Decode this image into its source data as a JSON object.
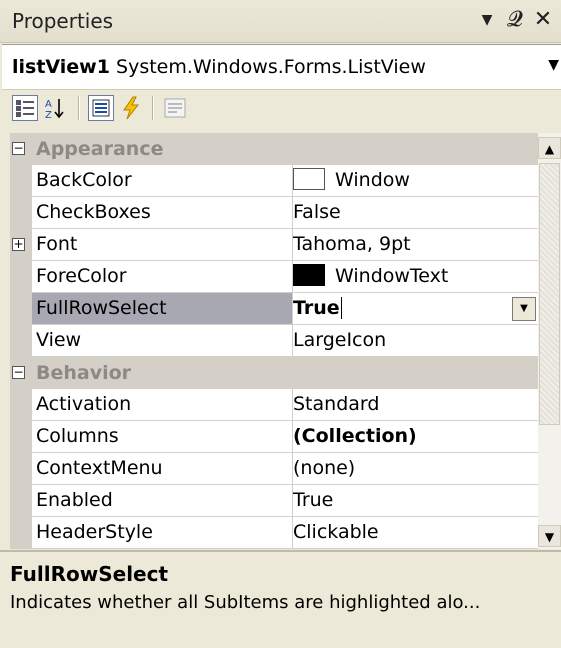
{
  "window": {
    "title": "Properties"
  },
  "object_selector": {
    "name": "listView1",
    "type": "System.Windows.Forms.ListView"
  },
  "toolbar": {
    "buttons": [
      "categorized-icon",
      "alphabetical-icon",
      "properties-icon",
      "events-icon",
      "property-pages-icon"
    ]
  },
  "grid": {
    "appearance_label": "Appearance",
    "behavior_label": "Behavior",
    "rows": [
      {
        "name": "BackColor",
        "value": "Window",
        "swatch": "#ffffff"
      },
      {
        "name": "CheckBoxes",
        "value": "False"
      },
      {
        "name": "Font",
        "value": "Tahoma, 9pt"
      },
      {
        "name": "ForeColor",
        "value": "WindowText",
        "swatch": "#000000"
      },
      {
        "name": "FullRowSelect",
        "value": "True"
      },
      {
        "name": "View",
        "value": "LargeIcon"
      },
      {
        "name": "Activation",
        "value": "Standard"
      },
      {
        "name": "Columns",
        "value": "(Collection)"
      },
      {
        "name": "ContextMenu",
        "value": "(none)"
      },
      {
        "name": "Enabled",
        "value": "True"
      },
      {
        "name": "HeaderStyle",
        "value": "Clickable"
      }
    ]
  },
  "description": {
    "title": "FullRowSelect",
    "text": "Indicates whether all SubItems are highlighted alo..."
  }
}
